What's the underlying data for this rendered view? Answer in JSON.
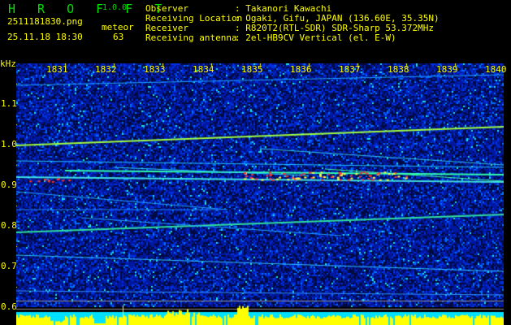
{
  "header": {
    "app_name": "H R O F F T",
    "version": "1.0.0",
    "filename": "2511181830.png",
    "datetime": "25.11.18 18:30",
    "meteor_label": "meteor",
    "meteor_count": "63",
    "info": [
      {
        "label": "Observer",
        "value": ": Takanori Kawachi"
      },
      {
        "label": "Receiving Location",
        "value": ": Ogaki, Gifu, JAPAN (136.60E, 35.35N)"
      },
      {
        "label": "Receiver",
        "value": ": R820T2(RTL-SDR) SDR-Sharp 53.372MHz"
      },
      {
        "label": "Receiving antenna",
        "value": ": 2el-HB9CV Vertical (el. E-W)"
      }
    ]
  },
  "chart_data": {
    "type": "heatmap",
    "ylabel": "kHz",
    "ylim": [
      0.57,
      1.2
    ],
    "x_ticks": [
      "1831",
      "1832",
      "1833",
      "1834",
      "1835",
      "1836",
      "1837",
      "1838",
      "1839",
      "1840"
    ],
    "y_ticks": [
      "1.1",
      "1.0",
      "0.9",
      "0.8",
      "0.7",
      "0.6"
    ],
    "colors": {
      "background": "#000000",
      "noise": "#0020c0",
      "signal": "#00ffff",
      "strong": "#ff2020",
      "text": "#ffff00",
      "bottom_bar": "#ffff00",
      "bottom_bg": "#00e0ff"
    }
  }
}
